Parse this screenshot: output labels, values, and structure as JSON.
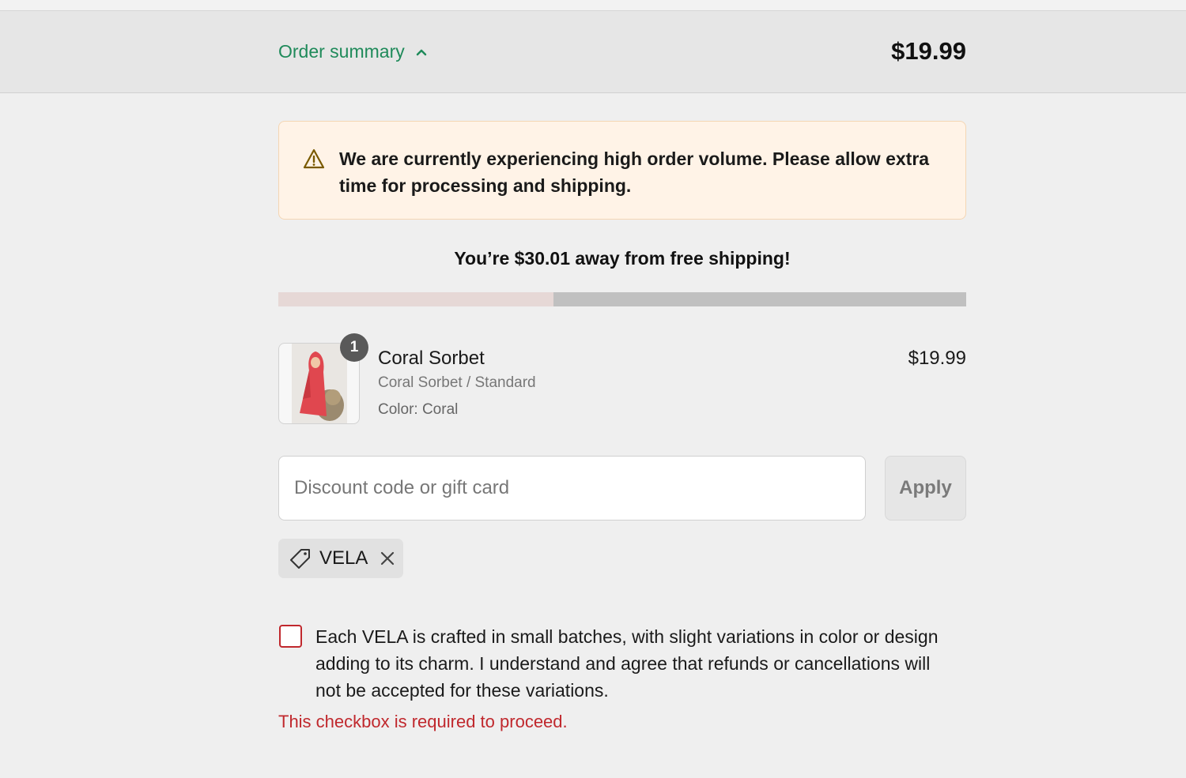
{
  "summary": {
    "toggle_label": "Order summary",
    "total": "$19.99"
  },
  "notice": {
    "icon": "warning-icon",
    "text": "We are currently experiencing high order volume. Please allow extra time for processing and shipping."
  },
  "shipping": {
    "message": "You’re $30.01 away from free shipping!",
    "progress_fraction": 0.4
  },
  "product": {
    "quantity": "1",
    "name": "Coral Sorbet",
    "variant": "Coral Sorbet / Standard",
    "color": "Color: Coral",
    "price": "$19.99"
  },
  "discount": {
    "placeholder": "Discount code or gift card",
    "value": "",
    "apply_label": "Apply",
    "applied_code": "VELA"
  },
  "agreement": {
    "text": "Each VELA is crafted in small batches, with slight variations in color or design adding to its charm. I understand and agree that refunds or cancellations will not be accepted for these variations.",
    "checked": false,
    "error": "This checkbox is required to proceed."
  },
  "colors": {
    "accent": "#1f8a5a",
    "error": "#c0282d",
    "notice_bg": "#fff3e7",
    "progress_fill": "#e6d8d6",
    "progress_track": "#c0c0c0"
  }
}
